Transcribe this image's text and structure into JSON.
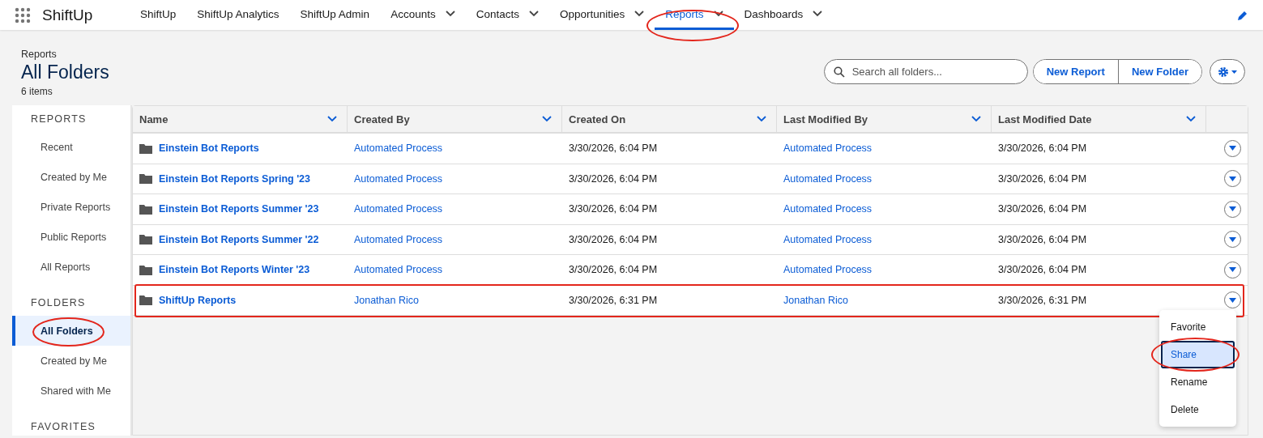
{
  "app": {
    "name": "ShiftUp"
  },
  "nav": [
    {
      "label": "ShiftUp",
      "dropdown": false,
      "selected": false,
      "highlighted": false
    },
    {
      "label": "ShiftUp Analytics",
      "dropdown": false,
      "selected": false,
      "highlighted": false
    },
    {
      "label": "ShiftUp Admin",
      "dropdown": false,
      "selected": false,
      "highlighted": false
    },
    {
      "label": "Accounts",
      "dropdown": true,
      "selected": false,
      "highlighted": false
    },
    {
      "label": "Contacts",
      "dropdown": true,
      "selected": false,
      "highlighted": false
    },
    {
      "label": "Opportunities",
      "dropdown": true,
      "selected": false,
      "highlighted": false
    },
    {
      "label": "Reports",
      "dropdown": true,
      "selected": true,
      "highlighted": true
    },
    {
      "label": "Dashboards",
      "dropdown": true,
      "selected": false,
      "highlighted": false
    }
  ],
  "header": {
    "breadcrumb": "Reports",
    "title": "All Folders",
    "count": "6 items"
  },
  "search": {
    "placeholder": "Search all folders..."
  },
  "buttons": [
    "New Report",
    "New Folder"
  ],
  "sidebar": [
    {
      "heading": "REPORTS",
      "items": [
        {
          "label": "Recent",
          "selected": false,
          "highlighted": false
        },
        {
          "label": "Created by Me",
          "selected": false,
          "highlighted": false
        },
        {
          "label": "Private Reports",
          "selected": false,
          "highlighted": false
        },
        {
          "label": "Public Reports",
          "selected": false,
          "highlighted": false
        },
        {
          "label": "All Reports",
          "selected": false,
          "highlighted": false
        }
      ]
    },
    {
      "heading": "FOLDERS",
      "items": [
        {
          "label": "All Folders",
          "selected": true,
          "highlighted": true
        },
        {
          "label": "Created by Me",
          "selected": false,
          "highlighted": false
        },
        {
          "label": "Shared with Me",
          "selected": false,
          "highlighted": false
        }
      ]
    },
    {
      "heading": "FAVORITES"
    }
  ],
  "table": {
    "columns": [
      "Name",
      "Created By",
      "Created On",
      "Last Modified By",
      "Last Modified Date"
    ],
    "rows": [
      {
        "name": "Einstein Bot Reports",
        "created_by": "Automated Process",
        "created_on": "3/30/2026, 6:04 PM",
        "modified_by": "Automated Process",
        "modified_date": "3/30/2026, 6:04 PM",
        "highlighted": false
      },
      {
        "name": "Einstein Bot Reports Spring '23",
        "created_by": "Automated Process",
        "created_on": "3/30/2026, 6:04 PM",
        "modified_by": "Automated Process",
        "modified_date": "3/30/2026, 6:04 PM",
        "highlighted": false
      },
      {
        "name": "Einstein Bot Reports Summer '23",
        "created_by": "Automated Process",
        "created_on": "3/30/2026, 6:04 PM",
        "modified_by": "Automated Process",
        "modified_date": "3/30/2026, 6:04 PM",
        "highlighted": false
      },
      {
        "name": "Einstein Bot Reports Summer '22",
        "created_by": "Automated Process",
        "created_on": "3/30/2026, 6:04 PM",
        "modified_by": "Automated Process",
        "modified_date": "3/30/2026, 6:04 PM",
        "highlighted": false
      },
      {
        "name": "Einstein Bot Reports Winter '23",
        "created_by": "Automated Process",
        "created_on": "3/30/2026, 6:04 PM",
        "modified_by": "Automated Process",
        "modified_date": "3/30/2026, 6:04 PM",
        "highlighted": false
      },
      {
        "name": "ShiftUp Reports",
        "created_by": "Jonathan Rico",
        "created_on": "3/30/2026, 6:31 PM",
        "modified_by": "Jonathan Rico",
        "modified_date": "3/30/2026, 6:31 PM",
        "highlighted": true
      }
    ]
  },
  "row_menu": [
    {
      "label": "Favorite",
      "selected": false,
      "highlighted": false
    },
    {
      "label": "Share",
      "selected": true,
      "highlighted": true
    },
    {
      "label": "Rename",
      "selected": false,
      "highlighted": false
    },
    {
      "label": "Delete",
      "selected": false,
      "highlighted": false
    }
  ]
}
